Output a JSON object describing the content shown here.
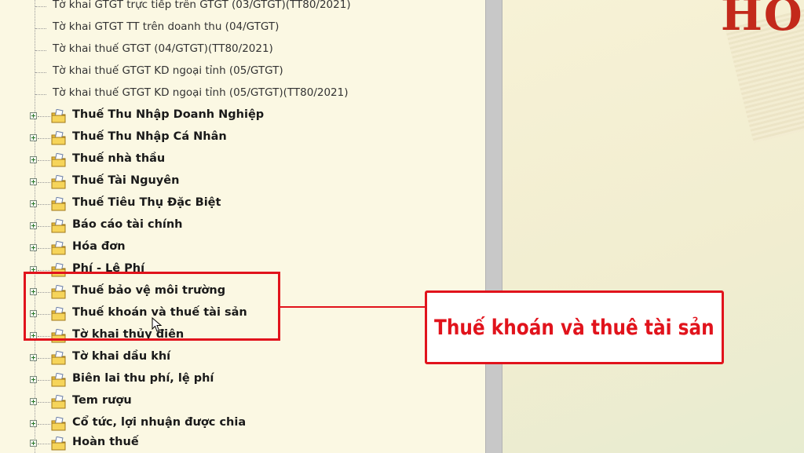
{
  "tree": {
    "sub_items": [
      {
        "label": "Tờ khai GTGT trực tiếp trên GTGT (03/GTGT)(TT80/2021)"
      },
      {
        "label": "Tờ khai GTGT TT trên doanh thu (04/GTGT)"
      },
      {
        "label": "Tờ khai thuế GTGT (04/GTGT)(TT80/2021)"
      },
      {
        "label": "Tờ khai thuế GTGT KD ngoại tỉnh (05/GTGT)"
      },
      {
        "label": "Tờ khai thuế GTGT KD ngoại tỉnh (05/GTGT)(TT80/2021)"
      }
    ],
    "items": [
      {
        "label": "Thuế Thu Nhập Doanh Nghiệp"
      },
      {
        "label": "Thuế Thu Nhập Cá Nhân"
      },
      {
        "label": "Thuế nhà thầu"
      },
      {
        "label": "Thuế Tài Nguyên"
      },
      {
        "label": "Thuế Tiêu Thụ Đặc Biệt"
      },
      {
        "label": "Báo cáo tài chính"
      },
      {
        "label": "Hóa đơn"
      },
      {
        "label": "Phí - Lệ Phí"
      },
      {
        "label": "Thuế bảo vệ môi trường"
      },
      {
        "label": "Thuế khoán và thuế tài sản"
      },
      {
        "label": "Tờ khai thủy điện"
      },
      {
        "label": "Tờ khai dầu khí"
      },
      {
        "label": "Biên lai thu phí, lệ phí"
      },
      {
        "label": "Tem rượu"
      },
      {
        "label": "Cổ tức, lợi nhuận được chia"
      },
      {
        "label": "Hoàn thuế"
      }
    ]
  },
  "logo": {
    "text": "HO"
  },
  "callout": {
    "text": "Thuế khoán và thuê tài sản"
  },
  "colors": {
    "accent_red": "#e1131c",
    "logo_red": "#c3291b",
    "tree_background": "#fbf8e3",
    "scrollbar": "#c8c8c8"
  },
  "icons": {
    "expander": "plus-box-icon",
    "item": "folder-document-icon",
    "pointer": "mouse-cursor-icon"
  }
}
